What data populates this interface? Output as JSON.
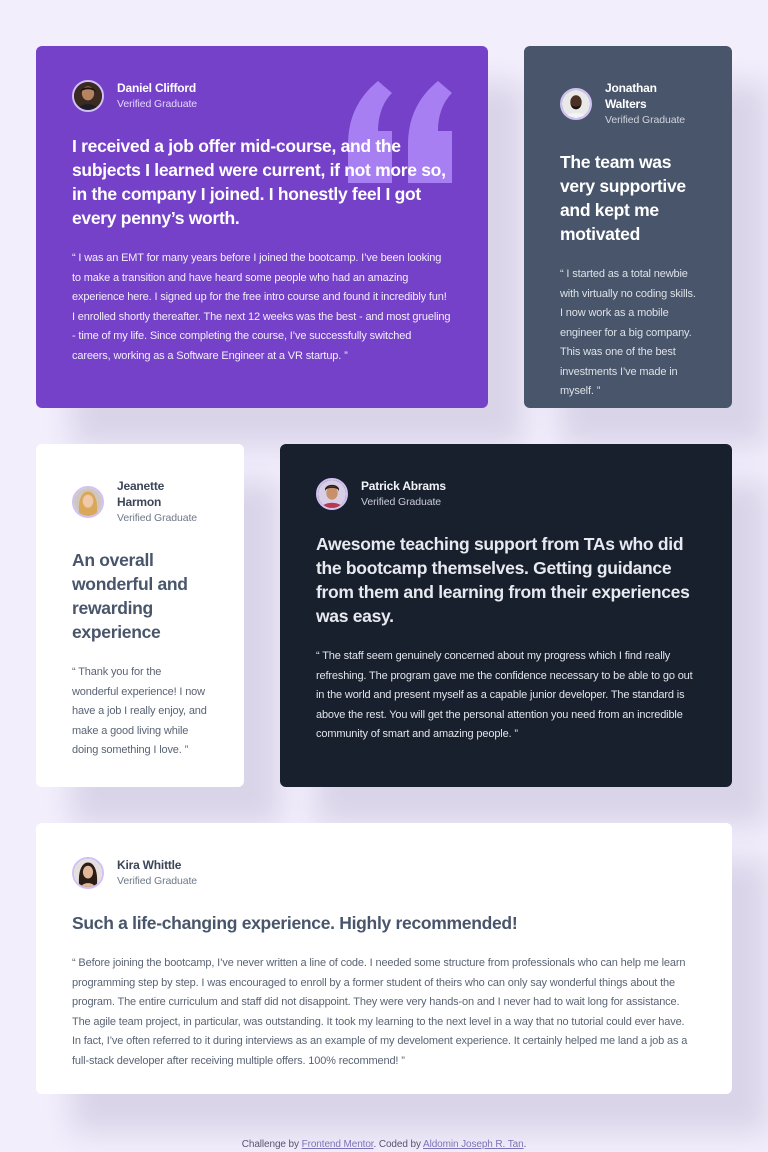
{
  "colors": {
    "page_bg": "#f2eefc",
    "purple": "#7541c8",
    "slate": "#48556a",
    "dark": "#19202d",
    "white": "#ffffff"
  },
  "testimonials": [
    {
      "name": "Daniel Clifford",
      "status": "Verified Graduate",
      "headline": "I received a job offer mid-course, and the subjects I learned were current, if not more so, in the company I joined. I honestly feel I got every penny’s worth.",
      "quote": "“ I was an EMT for many years before I joined the bootcamp. I’ve been looking to make a transition and have heard some people who had an amazing experience here. I signed up for the free intro course and found it incredibly fun! I enrolled shortly thereafter. The next 12 weeks was the best - and most grueling - time of my life. Since completing the course, I’ve successfully switched careers, working as a Software Engineer at a VR startup. ”"
    },
    {
      "name": "Jonathan Walters",
      "status": "Verified Graduate",
      "headline": "The team was very supportive and kept me motivated",
      "quote": "“ I started as a total newbie with virtually no coding skills. I now work as a mobile engineer for a big company. This was one of the best investments I’ve made in myself. ”"
    },
    {
      "name": "Jeanette Harmon",
      "status": "Verified Graduate",
      "headline": "An overall wonderful and rewarding experience",
      "quote": "“ Thank you for the wonderful experience! I now have a job I really enjoy, and make a good living while doing something I love. ”"
    },
    {
      "name": "Patrick Abrams",
      "status": "Verified Graduate",
      "headline": "Awesome teaching support from TAs who did the bootcamp themselves. Getting guidance from them and learning from their experiences was easy.",
      "quote": "“ The staff seem genuinely concerned about my progress which I find really refreshing. The program gave me the confidence necessary to be able to go out in the world and present myself as a capable junior developer. The standard is above the rest. You will get the personal attention you need from an incredible community of smart and amazing people. ”"
    },
    {
      "name": "Kira Whittle",
      "status": "Verified Graduate",
      "headline": "Such a life-changing experience. Highly recommended!",
      "quote": "“ Before joining the bootcamp, I’ve never written a line of code. I needed some structure from professionals who can help me learn programming step by step. I was encouraged to enroll by a former student of theirs who can only say wonderful things about the program. The entire curriculum and staff did not disappoint. They were very hands-on and I never had to wait long for assistance. The agile team project, in particular, was outstanding. It took my learning to the next level in a way that no tutorial could ever have. In fact, I’ve often referred to it during interviews as an example of my develoment experience. It certainly helped me land a job as a full-stack developer after receiving multiple offers. 100% recommend! ”"
    }
  ],
  "footer": {
    "prefix": "Challenge by",
    "link1": "Frontend Mentor",
    "middle": ". Coded by",
    "link2": "Aldomin Joseph R. Tan",
    "suffix": "."
  }
}
